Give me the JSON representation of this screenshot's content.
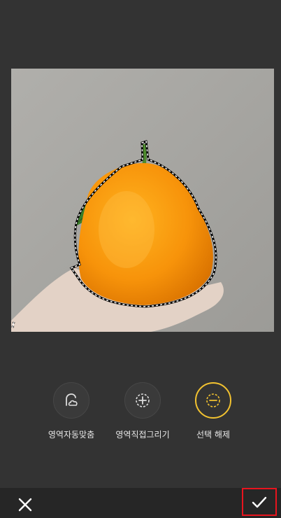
{
  "tools": [
    {
      "label": "영역자동맞춤",
      "icon": "auto-fit-selection-icon",
      "active": false
    },
    {
      "label": "영역직접그리기",
      "icon": "add-selection-icon",
      "active": false
    },
    {
      "label": "선택 해제",
      "icon": "deselect-icon",
      "active": true
    }
  ],
  "bottom_bar": {
    "close_icon": "close-icon",
    "confirm_icon": "check-icon"
  },
  "colors": {
    "background": "#333333",
    "bottom_bar": "#262626",
    "active_ring": "#f2c230",
    "confirm_highlight": "#e8141e"
  }
}
